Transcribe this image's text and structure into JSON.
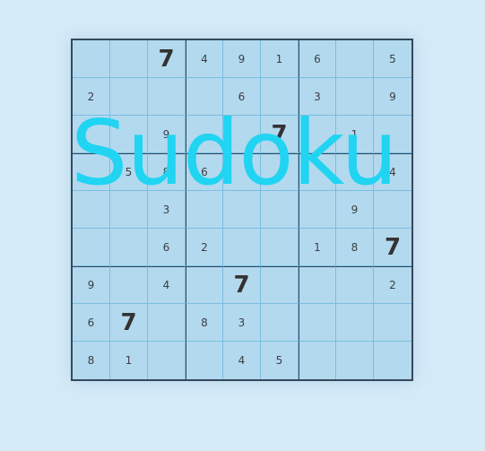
{
  "title": "Sudoku",
  "accent_color": "#20d4f2",
  "board": {
    "rows": [
      [
        "",
        "",
        "7",
        "4",
        "9",
        "1",
        "6",
        "",
        "5"
      ],
      [
        "2",
        "",
        "",
        "",
        "6",
        "",
        "3",
        "",
        "9"
      ],
      [
        "",
        "",
        "9",
        "",
        "",
        "7",
        "",
        "1",
        ""
      ],
      [
        "",
        "5",
        "8",
        "6",
        "",
        "",
        "",
        "",
        "4"
      ],
      [
        "",
        "",
        "3",
        "",
        "",
        "",
        "",
        "9",
        ""
      ],
      [
        "",
        "",
        "6",
        "2",
        "",
        "",
        "1",
        "8",
        "7"
      ],
      [
        "9",
        "",
        "4",
        "",
        "7",
        "",
        "",
        "",
        "2"
      ],
      [
        "6",
        "7",
        "",
        "8",
        "3",
        "",
        "",
        "",
        ""
      ],
      [
        "8",
        "1",
        "",
        "",
        "4",
        "5",
        "",
        "",
        ""
      ]
    ]
  }
}
